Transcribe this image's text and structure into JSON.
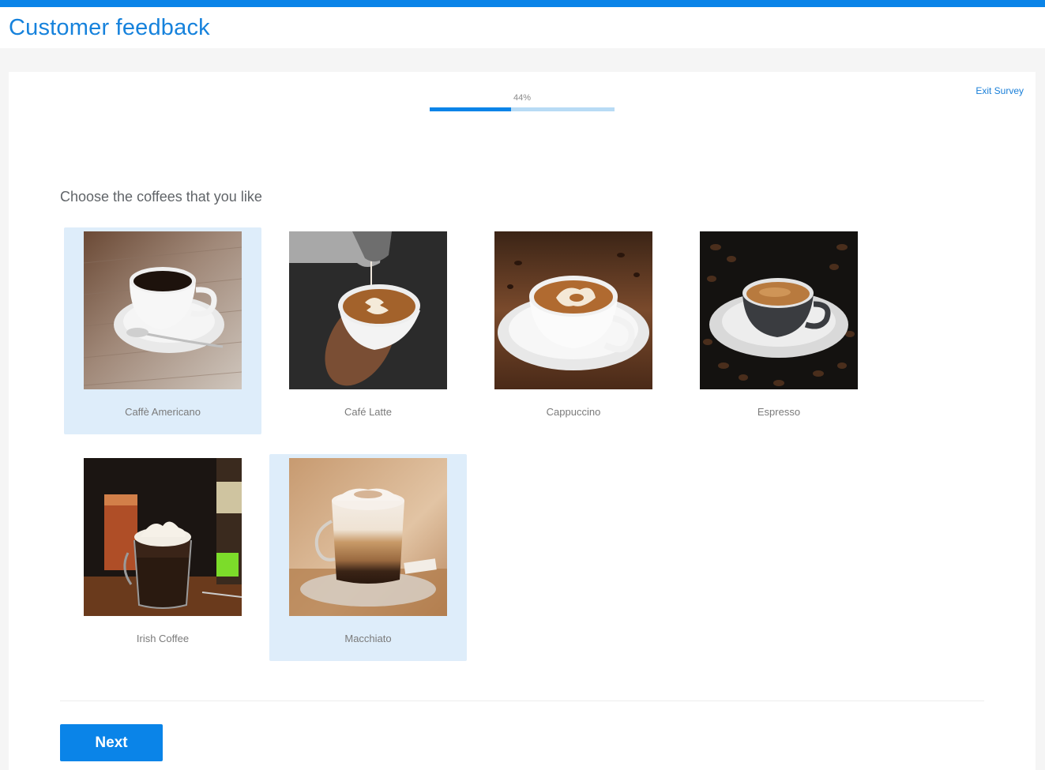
{
  "header": {
    "title": "Customer feedback"
  },
  "survey": {
    "exit_label": "Exit Survey",
    "progress": {
      "label": "44%",
      "value": 0.44
    },
    "question": "Choose the coffees that you like",
    "next_label": "Next",
    "choices": [
      {
        "label": "Caffè Americano",
        "selected": true,
        "image": "americano-photo"
      },
      {
        "label": "Café Latte",
        "selected": false,
        "image": "latte-photo"
      },
      {
        "label": "Cappuccino",
        "selected": false,
        "image": "cappuccino-photo"
      },
      {
        "label": "Espresso",
        "selected": false,
        "image": "espresso-photo"
      },
      {
        "label": "Irish Coffee",
        "selected": false,
        "image": "irish-coffee-photo"
      },
      {
        "label": "Macchiato",
        "selected": true,
        "image": "macchiato-photo"
      }
    ]
  },
  "colors": {
    "accent": "#0a84e8",
    "title": "#1682dc",
    "selected_bg": "#deedfa",
    "progress_track": "#b8dbf5"
  }
}
